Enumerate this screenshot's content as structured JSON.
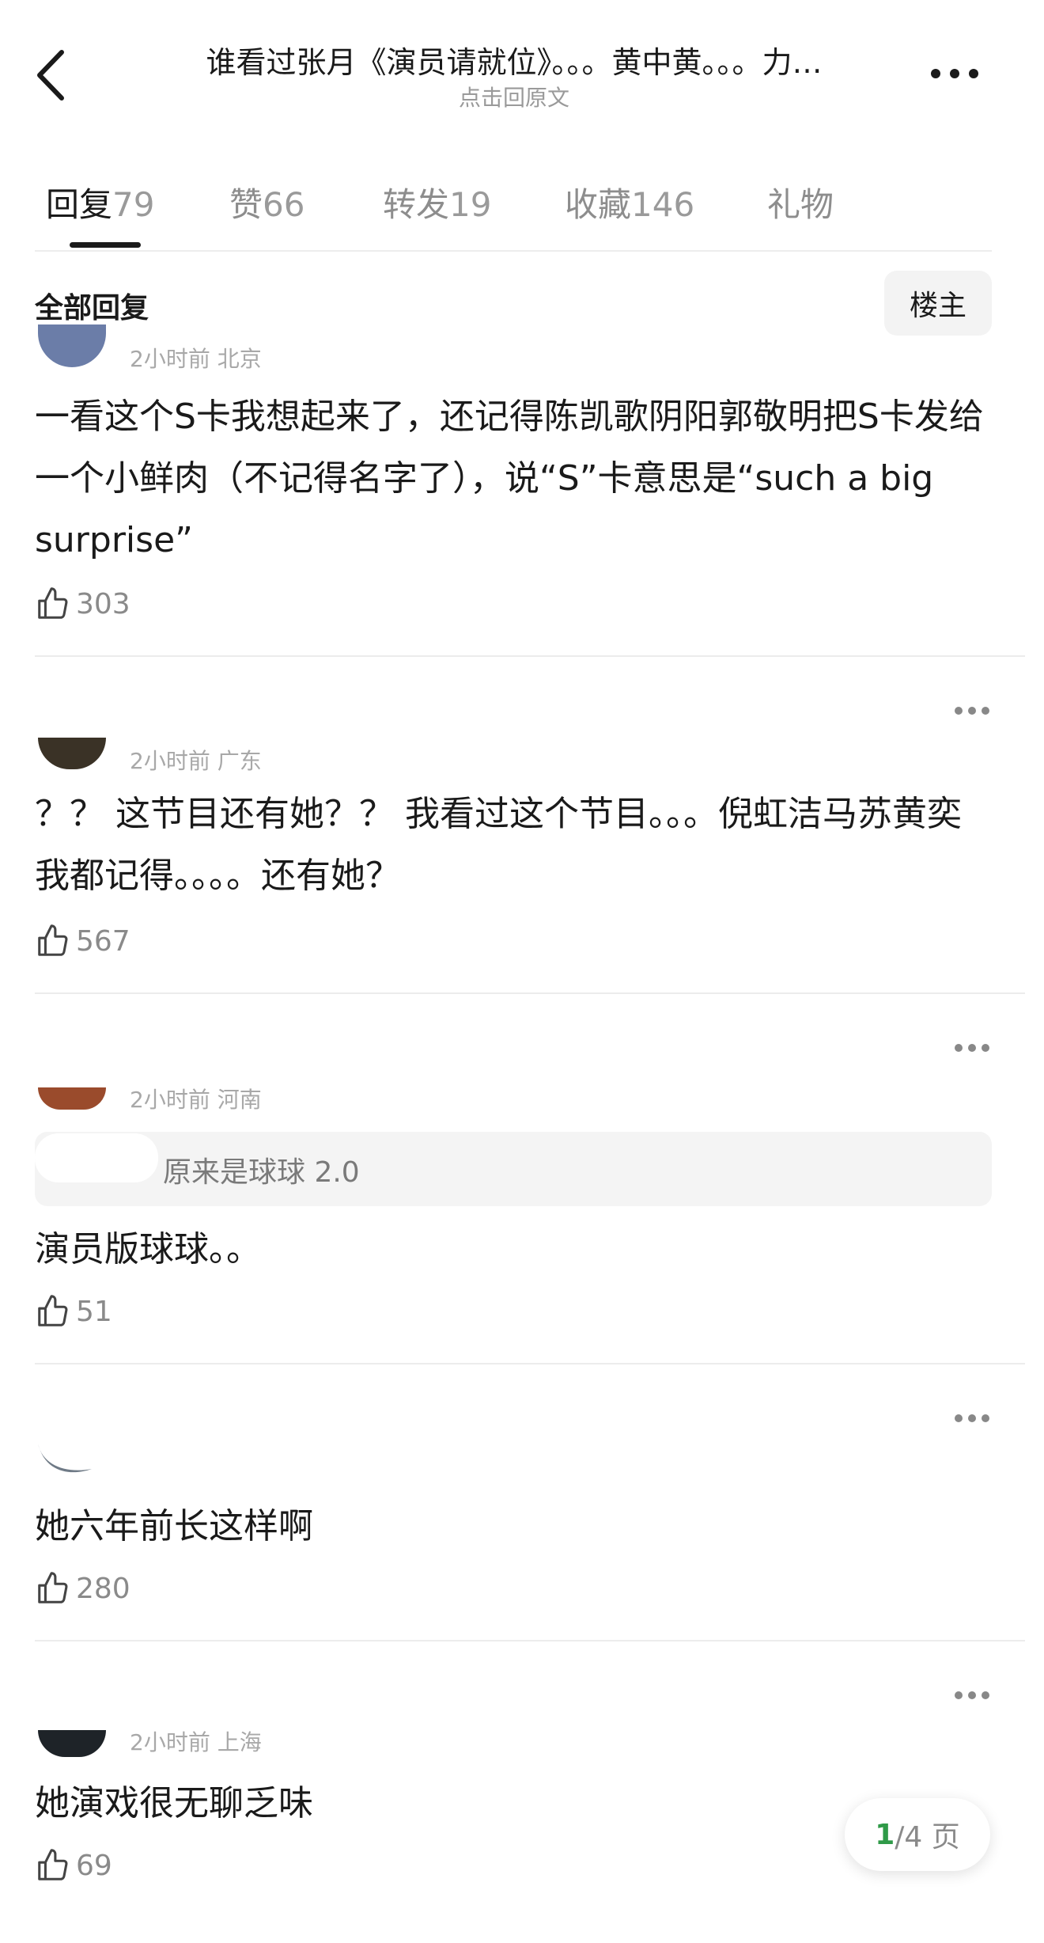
{
  "header": {
    "title": "谁看过张月《演员请就位》。。。黄中黄。。。力…",
    "subtitle": "点击回原文"
  },
  "tabs": [
    {
      "label": "回复",
      "count": "79"
    },
    {
      "label": "赞",
      "count": "66"
    },
    {
      "label": "转发",
      "count": "19"
    },
    {
      "label": "收藏",
      "count": "146"
    },
    {
      "label": "礼物",
      "count": ""
    }
  ],
  "filter": {
    "title": "全部回复",
    "owner_button": "楼主"
  },
  "comments": [
    {
      "meta": "2小时前 北京",
      "text": "一看这个S卡我想起来了，还记得陈凯歌阴阳郭敬明把S卡发给一个小鲜肉（不记得名字了），说“S”卡意思是“such a big surprise”",
      "likes": "303"
    },
    {
      "meta": "2小时前 广东",
      "text": "？？ 这节目还有她？？ 我看过这个节目。。。倪虹洁马苏黄奕我都记得。。。。还有她？",
      "likes": "567"
    },
    {
      "meta": "2小时前 河南",
      "quote": "原来是球球 2.0",
      "text": "演员版球球。。",
      "likes": "51"
    },
    {
      "meta": "",
      "text": "她六年前长这样啊",
      "likes": "280"
    },
    {
      "meta": "2小时前 上海",
      "text": "她演戏很无聊乏味",
      "likes": "69"
    }
  ],
  "pager": {
    "current": "1",
    "total": "/4 页"
  },
  "colors": {
    "accent": "#2f9a48",
    "text": "#1a1a1a",
    "muted": "#8a8a8a"
  }
}
